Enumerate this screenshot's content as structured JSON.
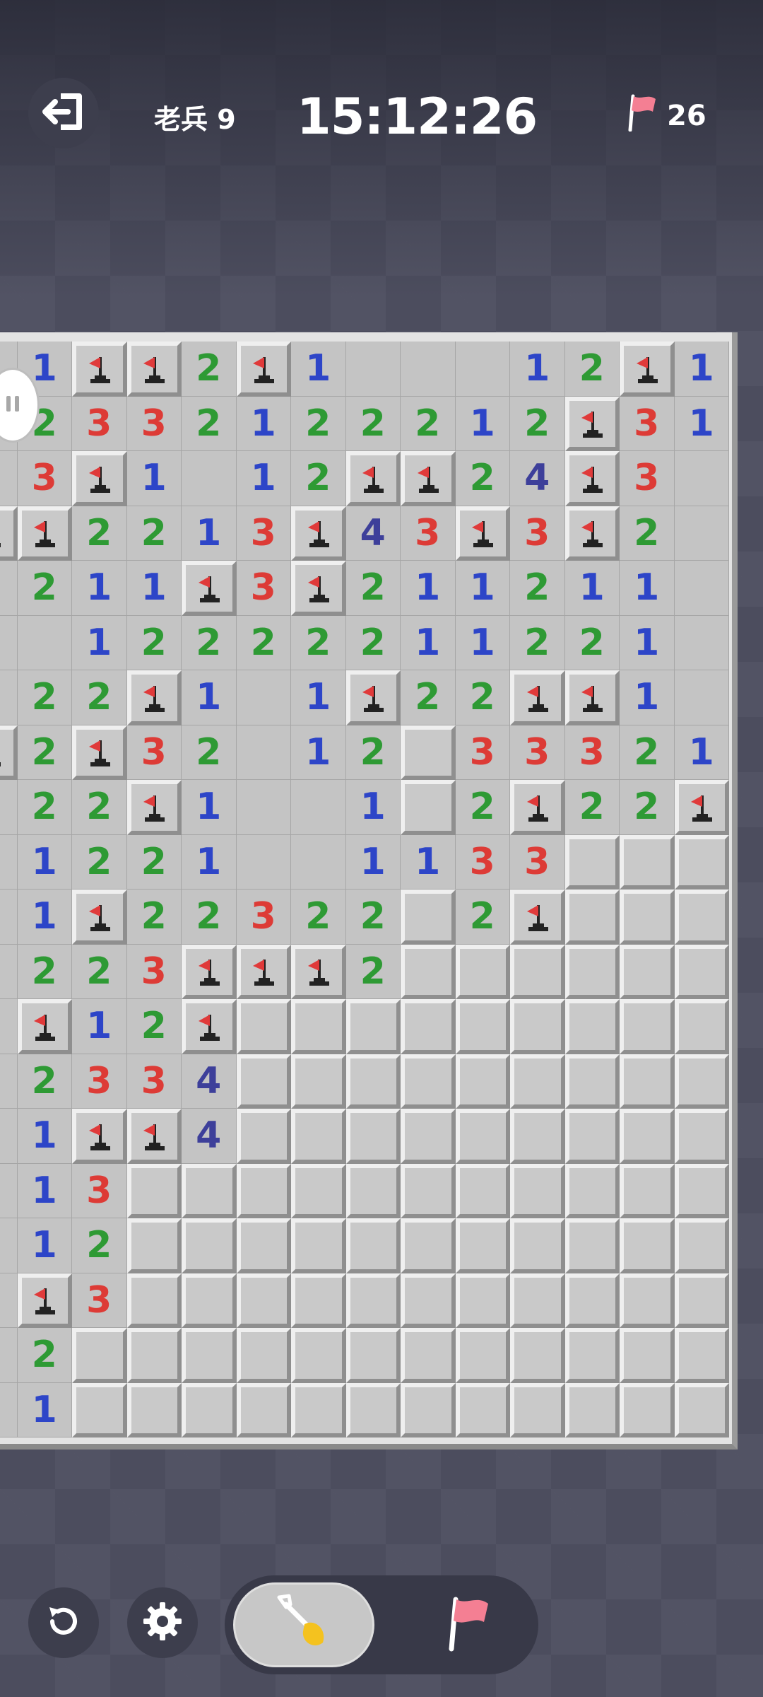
{
  "header": {
    "level_label": "老兵 9",
    "timer": "15:12:26",
    "flags_remaining": "26"
  },
  "icons": {
    "exit": "exit-icon",
    "flag": "flag-icon",
    "undo": "undo-icon",
    "settings": "gear-icon",
    "shovel": "shovel-icon"
  },
  "colors": {
    "n1": "#2d45c8",
    "n2": "#2e9a34",
    "n3": "#dd3b36",
    "n4": "#3d3f9a",
    "flag": "#e03a3a"
  },
  "board": {
    "cols": 14,
    "rows": 20,
    "cells": [
      "O",
      "1",
      "F",
      "F",
      "2",
      "F",
      "1",
      "O",
      "O",
      "O",
      "1",
      "2",
      "F",
      "1",
      "O",
      "2",
      "3",
      "3",
      "2",
      "1",
      "2",
      "2",
      "2",
      "1",
      "2",
      "F",
      "3",
      "1",
      "O",
      "3",
      "F",
      "1",
      "O",
      "1",
      "2",
      "F",
      "F",
      "2",
      "4",
      "F",
      "3",
      "O",
      "F",
      "F",
      "2",
      "2",
      "1",
      "3",
      "F",
      "4",
      "3",
      "F",
      "3",
      "F",
      "2",
      "O",
      "O",
      "2",
      "1",
      "1",
      "F",
      "3",
      "F",
      "2",
      "1",
      "1",
      "2",
      "1",
      "1",
      "O",
      "O",
      "O",
      "1",
      "2",
      "2",
      "2",
      "2",
      "2",
      "1",
      "1",
      "2",
      "2",
      "1",
      "O",
      "O",
      "2",
      "2",
      "F",
      "1",
      "O",
      "1",
      "F",
      "2",
      "2",
      "F",
      "F",
      "1",
      "O",
      "F",
      "2",
      "F",
      "3",
      "2",
      "O",
      "1",
      "2",
      "H",
      "3",
      "3",
      "3",
      "2",
      "1",
      "O",
      "2",
      "2",
      "F",
      "1",
      "O",
      "O",
      "1",
      "H",
      "2",
      "F",
      "2",
      "2",
      "F",
      "O",
      "1",
      "2",
      "2",
      "1",
      "O",
      "O",
      "1",
      "1",
      "3",
      "3",
      "H",
      "H",
      "H",
      "O",
      "1",
      "F",
      "2",
      "2",
      "3",
      "2",
      "2",
      "H",
      "2",
      "F",
      "H",
      "H",
      "H",
      "O",
      "2",
      "2",
      "3",
      "F",
      "F",
      "F",
      "2",
      "H",
      "H",
      "H",
      "H",
      "H",
      "H",
      "O",
      "F",
      "1",
      "2",
      "F",
      "H",
      "H",
      "H",
      "H",
      "H",
      "H",
      "H",
      "H",
      "H",
      "O",
      "2",
      "3",
      "3",
      "4",
      "H",
      "H",
      "H",
      "H",
      "H",
      "H",
      "H",
      "H",
      "H",
      "O",
      "1",
      "F",
      "F",
      "4",
      "H",
      "H",
      "H",
      "H",
      "H",
      "H",
      "H",
      "H",
      "H",
      "O",
      "1",
      "3",
      "H",
      "H",
      "H",
      "H",
      "H",
      "H",
      "H",
      "H",
      "H",
      "H",
      "H",
      "O",
      "1",
      "2",
      "H",
      "H",
      "H",
      "H",
      "H",
      "H",
      "H",
      "H",
      "H",
      "H",
      "H",
      "O",
      "F",
      "3",
      "H",
      "H",
      "H",
      "H",
      "H",
      "H",
      "H",
      "H",
      "H",
      "H",
      "H",
      "O",
      "2",
      "H",
      "H",
      "H",
      "H",
      "H",
      "H",
      "H",
      "H",
      "H",
      "H",
      "H",
      "H",
      "O",
      "1",
      "H",
      "H",
      "H",
      "H",
      "H",
      "H",
      "H",
      "H",
      "H",
      "H",
      "H",
      "H"
    ]
  },
  "controls": {
    "active_mode": "dig"
  }
}
